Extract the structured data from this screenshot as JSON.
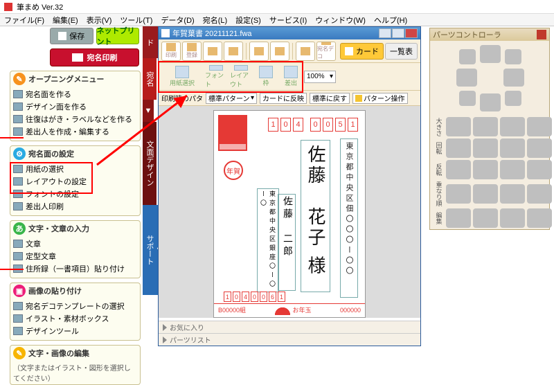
{
  "app": {
    "title": "筆まめ Ver.32"
  },
  "menus": [
    "ファイル(F)",
    "編集(E)",
    "表示(V)",
    "ツール(T)",
    "データ(D)",
    "宛名(L)",
    "設定(S)",
    "サービス(I)",
    "ウィンドウ(W)",
    "ヘルプ(H)"
  ],
  "left": {
    "save": "保存",
    "netprint": "ネットプリント",
    "atena_print": "宛名印刷",
    "group1": {
      "title": "オープニングメニュー",
      "items": [
        "宛名面を作る",
        "デザイン面を作る",
        "往復はがき・ラベルなどを作る",
        "差出人を作成・編集する"
      ]
    },
    "group2": {
      "title": "宛名面の設定",
      "items": [
        "用紙の選択",
        "レイアウトの設定",
        "フォントの設定",
        "差出人印刷"
      ]
    },
    "group3": {
      "title": "文字・文章の入力",
      "items": [
        "文章",
        "定型文章",
        "住所録（一書項目）貼り付け"
      ]
    },
    "group4": {
      "title": "画像の貼り付け",
      "items": [
        "宛名デコテンプレートの選択",
        "イラスト・素材ボックス",
        "デザインツール"
      ]
    },
    "group5": {
      "title": "文字・画像の編集"
    },
    "hint": "（文字またはイラスト・図形を選択してください）"
  },
  "vtabs": [
    "カード",
    "宛名",
    "▼",
    "文面デザイン",
    "サポート"
  ],
  "doc": {
    "title": "年賀葉書  20211121.fwa",
    "tb1": {
      "card": "カード",
      "list": "一覧表",
      "small": [
        "印刷",
        "登録",
        "",
        "",
        "",
        "",
        "",
        "宛名デコ"
      ]
    },
    "tb2": {
      "paper": "用紙選択",
      "font": "フォント",
      "layout": "レイアウト",
      "frame": "枠",
      "sender": "差出",
      "zoom": "100%"
    },
    "tb3": {
      "label": "印刷時のパタ",
      "pattern": "標準パターン",
      "reflect": "カードに反映",
      "revert": "標準に戻す",
      "ops": "パターン操作"
    },
    "hagaki": {
      "zip_to": [
        "1",
        "0",
        "4",
        "0",
        "0",
        "5",
        "1"
      ],
      "addr_to": "東京都中央区佃〇〇〇ー〇〇",
      "name_to": "佐藤　花子 様",
      "name_from": "佐藤　二郎",
      "addr_from": "東京都中央区銀座〇ー〇ー〇",
      "zip_from": [
        "1",
        "0",
        "4",
        "0",
        "0",
        "6",
        "1"
      ],
      "nenga": "年賀",
      "lot_left": "B00000組",
      "lot_mid": "お年玉",
      "lot_right": "000000"
    },
    "bottom": {
      "fav": "お気に入り",
      "parts": "パーツリスト"
    }
  },
  "ctrl": {
    "title": "パーツコントローラ",
    "rows": [
      "大きさ",
      "回転",
      "反転",
      "重なり順",
      "編集"
    ]
  }
}
